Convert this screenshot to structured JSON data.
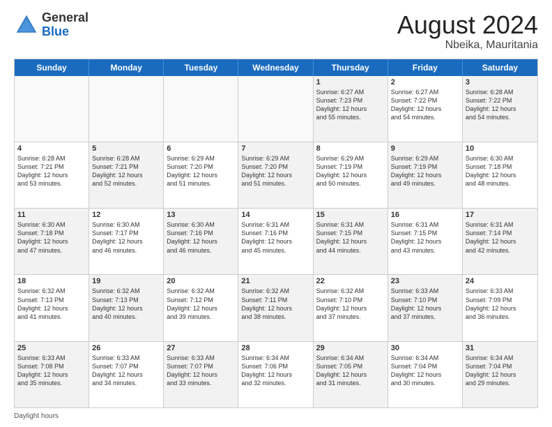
{
  "header": {
    "logo_general": "General",
    "logo_blue": "Blue",
    "month_year": "August 2024",
    "location": "Nbeika, Mauritania"
  },
  "days_of_week": [
    "Sunday",
    "Monday",
    "Tuesday",
    "Wednesday",
    "Thursday",
    "Friday",
    "Saturday"
  ],
  "footer_label": "Daylight hours",
  "weeks": [
    [
      {
        "day": "",
        "text": "",
        "empty": true
      },
      {
        "day": "",
        "text": "",
        "empty": true
      },
      {
        "day": "",
        "text": "",
        "empty": true
      },
      {
        "day": "",
        "text": "",
        "empty": true
      },
      {
        "day": "1",
        "text": "Sunrise: 6:27 AM\nSunset: 7:23 PM\nDaylight: 12 hours\nand 55 minutes.",
        "shaded": true
      },
      {
        "day": "2",
        "text": "Sunrise: 6:27 AM\nSunset: 7:22 PM\nDaylight: 12 hours\nand 54 minutes.",
        "shaded": false
      },
      {
        "day": "3",
        "text": "Sunrise: 6:28 AM\nSunset: 7:22 PM\nDaylight: 12 hours\nand 54 minutes.",
        "shaded": true
      }
    ],
    [
      {
        "day": "4",
        "text": "Sunrise: 6:28 AM\nSunset: 7:21 PM\nDaylight: 12 hours\nand 53 minutes.",
        "shaded": false
      },
      {
        "day": "5",
        "text": "Sunrise: 6:28 AM\nSunset: 7:21 PM\nDaylight: 12 hours\nand 52 minutes.",
        "shaded": true
      },
      {
        "day": "6",
        "text": "Sunrise: 6:29 AM\nSunset: 7:20 PM\nDaylight: 12 hours\nand 51 minutes.",
        "shaded": false
      },
      {
        "day": "7",
        "text": "Sunrise: 6:29 AM\nSunset: 7:20 PM\nDaylight: 12 hours\nand 51 minutes.",
        "shaded": true
      },
      {
        "day": "8",
        "text": "Sunrise: 6:29 AM\nSunset: 7:19 PM\nDaylight: 12 hours\nand 50 minutes.",
        "shaded": false
      },
      {
        "day": "9",
        "text": "Sunrise: 6:29 AM\nSunset: 7:19 PM\nDaylight: 12 hours\nand 49 minutes.",
        "shaded": true
      },
      {
        "day": "10",
        "text": "Sunrise: 6:30 AM\nSunset: 7:18 PM\nDaylight: 12 hours\nand 48 minutes.",
        "shaded": false
      }
    ],
    [
      {
        "day": "11",
        "text": "Sunrise: 6:30 AM\nSunset: 7:18 PM\nDaylight: 12 hours\nand 47 minutes.",
        "shaded": true
      },
      {
        "day": "12",
        "text": "Sunrise: 6:30 AM\nSunset: 7:17 PM\nDaylight: 12 hours\nand 46 minutes.",
        "shaded": false
      },
      {
        "day": "13",
        "text": "Sunrise: 6:30 AM\nSunset: 7:16 PM\nDaylight: 12 hours\nand 46 minutes.",
        "shaded": true
      },
      {
        "day": "14",
        "text": "Sunrise: 6:31 AM\nSunset: 7:16 PM\nDaylight: 12 hours\nand 45 minutes.",
        "shaded": false
      },
      {
        "day": "15",
        "text": "Sunrise: 6:31 AM\nSunset: 7:15 PM\nDaylight: 12 hours\nand 44 minutes.",
        "shaded": true
      },
      {
        "day": "16",
        "text": "Sunrise: 6:31 AM\nSunset: 7:15 PM\nDaylight: 12 hours\nand 43 minutes.",
        "shaded": false
      },
      {
        "day": "17",
        "text": "Sunrise: 6:31 AM\nSunset: 7:14 PM\nDaylight: 12 hours\nand 42 minutes.",
        "shaded": true
      }
    ],
    [
      {
        "day": "18",
        "text": "Sunrise: 6:32 AM\nSunset: 7:13 PM\nDaylight: 12 hours\nand 41 minutes.",
        "shaded": false
      },
      {
        "day": "19",
        "text": "Sunrise: 6:32 AM\nSunset: 7:13 PM\nDaylight: 12 hours\nand 40 minutes.",
        "shaded": true
      },
      {
        "day": "20",
        "text": "Sunrise: 6:32 AM\nSunset: 7:12 PM\nDaylight: 12 hours\nand 39 minutes.",
        "shaded": false
      },
      {
        "day": "21",
        "text": "Sunrise: 6:32 AM\nSunset: 7:11 PM\nDaylight: 12 hours\nand 38 minutes.",
        "shaded": true
      },
      {
        "day": "22",
        "text": "Sunrise: 6:32 AM\nSunset: 7:10 PM\nDaylight: 12 hours\nand 37 minutes.",
        "shaded": false
      },
      {
        "day": "23",
        "text": "Sunrise: 6:33 AM\nSunset: 7:10 PM\nDaylight: 12 hours\nand 37 minutes.",
        "shaded": true
      },
      {
        "day": "24",
        "text": "Sunrise: 6:33 AM\nSunset: 7:09 PM\nDaylight: 12 hours\nand 36 minutes.",
        "shaded": false
      }
    ],
    [
      {
        "day": "25",
        "text": "Sunrise: 6:33 AM\nSunset: 7:08 PM\nDaylight: 12 hours\nand 35 minutes.",
        "shaded": true
      },
      {
        "day": "26",
        "text": "Sunrise: 6:33 AM\nSunset: 7:07 PM\nDaylight: 12 hours\nand 34 minutes.",
        "shaded": false
      },
      {
        "day": "27",
        "text": "Sunrise: 6:33 AM\nSunset: 7:07 PM\nDaylight: 12 hours\nand 33 minutes.",
        "shaded": true
      },
      {
        "day": "28",
        "text": "Sunrise: 6:34 AM\nSunset: 7:06 PM\nDaylight: 12 hours\nand 32 minutes.",
        "shaded": false
      },
      {
        "day": "29",
        "text": "Sunrise: 6:34 AM\nSunset: 7:05 PM\nDaylight: 12 hours\nand 31 minutes.",
        "shaded": true
      },
      {
        "day": "30",
        "text": "Sunrise: 6:34 AM\nSunset: 7:04 PM\nDaylight: 12 hours\nand 30 minutes.",
        "shaded": false
      },
      {
        "day": "31",
        "text": "Sunrise: 6:34 AM\nSunset: 7:04 PM\nDaylight: 12 hours\nand 29 minutes.",
        "shaded": true
      }
    ]
  ]
}
